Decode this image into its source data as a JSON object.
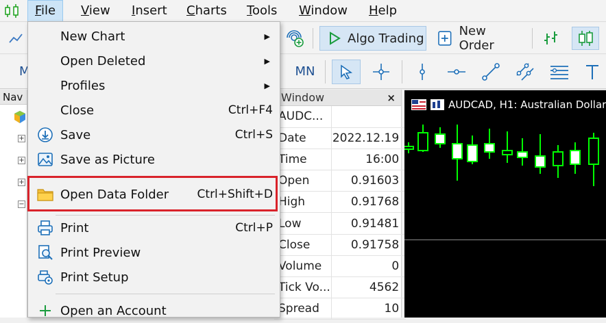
{
  "menu": {
    "items": [
      {
        "label": "File",
        "underline": "F",
        "rest": "ile"
      },
      {
        "label": "View",
        "underline": "V",
        "rest": "iew"
      },
      {
        "label": "Insert",
        "underline": "I",
        "rest": "nsert"
      },
      {
        "label": "Charts",
        "underline": "C",
        "rest": "harts"
      },
      {
        "label": "Tools",
        "underline": "T",
        "rest": "ools"
      },
      {
        "label": "Window",
        "underline": "W",
        "rest": "indow"
      },
      {
        "label": "Help",
        "underline": "H",
        "rest": "elp"
      }
    ]
  },
  "toolbar": {
    "algo_trading": "Algo Trading",
    "new_order": "New Order",
    "timeframe_mn": "MN",
    "timeframe_m_partial": "M"
  },
  "navigator": {
    "header_partial": "Nav"
  },
  "file_menu": {
    "items": [
      {
        "label": "New Chart",
        "shortcut": "",
        "submenu": true,
        "icon": "none"
      },
      {
        "label": "Open Deleted",
        "shortcut": "",
        "submenu": true,
        "icon": "none"
      },
      {
        "label": "Profiles",
        "shortcut": "",
        "submenu": true,
        "icon": "none"
      },
      {
        "label": "Close",
        "shortcut": "Ctrl+F4",
        "submenu": false,
        "icon": "none"
      },
      {
        "label": "Save",
        "shortcut": "Ctrl+S",
        "submenu": false,
        "icon": "save-icon"
      },
      {
        "label": "Save as Picture",
        "shortcut": "",
        "submenu": false,
        "icon": "picture-icon"
      },
      {
        "label": "Open Data Folder",
        "shortcut": "Ctrl+Shift+D",
        "submenu": false,
        "icon": "folder-icon",
        "highlighted": true
      },
      {
        "label": "Print",
        "shortcut": "Ctrl+P",
        "submenu": false,
        "icon": "printer-icon"
      },
      {
        "label": "Print Preview",
        "shortcut": "",
        "submenu": false,
        "icon": "print-preview-icon"
      },
      {
        "label": "Print Setup",
        "shortcut": "",
        "submenu": false,
        "icon": "print-setup-icon"
      },
      {
        "label": "Open an Account",
        "shortcut": "",
        "submenu": false,
        "icon": "plus-icon"
      }
    ]
  },
  "data_window": {
    "title_partial": "Window",
    "close": "×",
    "rows": [
      {
        "key": "AUDC...",
        "value": ""
      },
      {
        "key": "Date",
        "value": "2022.12.19"
      },
      {
        "key": "Time",
        "value": "16:00"
      },
      {
        "key": "Open",
        "value": "0.91603"
      },
      {
        "key": "High",
        "value": "0.91768"
      },
      {
        "key": "Low",
        "value": "0.91481"
      },
      {
        "key": "Close",
        "value": "0.91758"
      },
      {
        "key": "Volume",
        "value": "0"
      },
      {
        "key": "Tick Vo...",
        "value": "4562"
      },
      {
        "key": "Spread",
        "value": "10"
      }
    ]
  },
  "chart": {
    "title": "AUDCAD, H1:  Australian Dollar",
    "bull_color": "#00ff00",
    "bear_color": "#ffffff",
    "background": "#000000"
  },
  "colors": {
    "highlight": "#d9222a",
    "accent": "#0078d7"
  }
}
